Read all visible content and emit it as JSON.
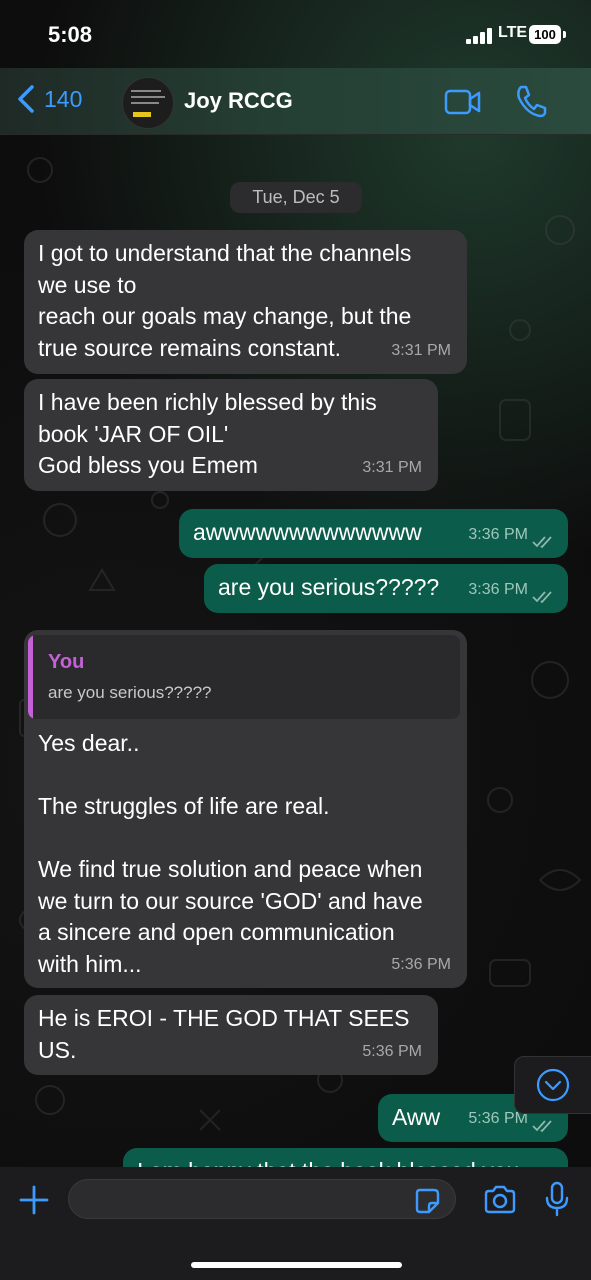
{
  "status_bar": {
    "time": "5:08",
    "network": "LTE",
    "battery": "100"
  },
  "header": {
    "back_count": "140",
    "contact_name": "Joy RCCG"
  },
  "date_separator": "Tue, Dec 5",
  "messages": [
    {
      "direction": "incoming",
      "text": "I got to understand that the channels\nwe use to\nreach our goals may change, but the\ntrue source remains constant.",
      "time": "3:31 PM"
    },
    {
      "direction": "incoming",
      "text": "I have been richly blessed by this\nbook 'JAR OF OIL'\nGod bless you Emem",
      "time": "3:31 PM"
    },
    {
      "direction": "outgoing",
      "text": "awwwwwwwwwwwww",
      "time": "3:36 PM"
    },
    {
      "direction": "outgoing",
      "text": "are you serious?????",
      "time": "3:36 PM"
    },
    {
      "direction": "incoming",
      "reply_to": {
        "author": "You",
        "text": "are you serious?????"
      },
      "text": "Yes dear..\n\nThe struggles of life are real.\n\nWe find true solution and peace when\nwe turn to our source 'GOD' and have\na sincere and open communication\nwith him...",
      "time": "5:36 PM"
    },
    {
      "direction": "incoming",
      "text": "He is EROI - THE GOD THAT SEES\nUS.",
      "time": "5:36 PM"
    },
    {
      "direction": "outgoing",
      "text": "Aww",
      "time": "5:36 PM"
    },
    {
      "direction": "outgoing",
      "text": "I am happy that the book blessed you",
      "time": ""
    }
  ],
  "composer": {
    "input_value": ""
  },
  "colors": {
    "incoming_bubble": "#363638",
    "outgoing_bubble": "#0b5c4a",
    "accent": "#3d9bff",
    "quote_accent": "#c561d6"
  },
  "icons": [
    "chevron-left-icon",
    "video-call-icon",
    "phone-icon",
    "plus-icon",
    "sticker-icon",
    "camera-icon",
    "microphone-icon",
    "chevron-down-icon",
    "double-check-icon"
  ]
}
